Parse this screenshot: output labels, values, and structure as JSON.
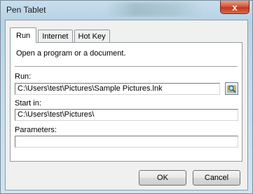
{
  "window": {
    "title": "Pen Tablet",
    "close_glyph": "x"
  },
  "tabs": [
    {
      "label": "Run",
      "active": true
    },
    {
      "label": "Internet",
      "active": false
    },
    {
      "label": "Hot Key",
      "active": false
    }
  ],
  "run_tab": {
    "description": "Open a program or a document.",
    "run_label": "Run:",
    "run_value": "C:\\Users\\test\\Pictures\\Sample Pictures.lnk",
    "start_in_label": "Start in:",
    "start_in_value": "C:\\Users\\test\\Pictures\\",
    "parameters_label": "Parameters:",
    "parameters_value": "",
    "browse_icon": "magnifier-browse-icon"
  },
  "buttons": {
    "ok": "OK",
    "cancel": "Cancel"
  }
}
